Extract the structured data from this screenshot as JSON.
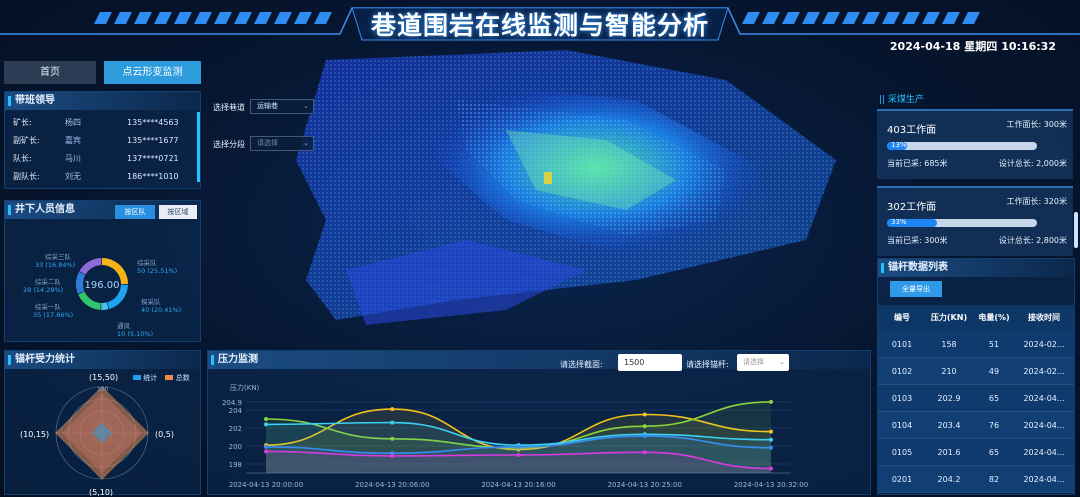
{
  "header": {
    "title": "巷道围岩在线监测与智能分析",
    "date": "2024-04-18",
    "weekday": "星期四",
    "time": "10:16:32"
  },
  "nav": {
    "home": "首页",
    "cloud": "点云形变监测"
  },
  "leaders": {
    "title": "带班领导",
    "rows": [
      {
        "role": "矿长:",
        "name": "杨四",
        "phone": "135****4563"
      },
      {
        "role": "副矿长:",
        "name": "嘉宾",
        "phone": "135****1677"
      },
      {
        "role": "队长:",
        "name": "马川",
        "phone": "137****0721"
      },
      {
        "role": "副队长:",
        "name": "刘无",
        "phone": "186****1010"
      }
    ]
  },
  "personnel": {
    "title": "井下人员信息",
    "tab_team": "按区队",
    "tab_area": "按区域",
    "total": "196.00",
    "segments": [
      {
        "label": "综采队",
        "value": "50 (25.51%)",
        "count": 50,
        "color": "#f5b316"
      },
      {
        "label": "探采队",
        "value": "40 (20.41%)",
        "count": 40,
        "color": "#1ea2f0"
      },
      {
        "label": "通风",
        "value": "10 (5.10%)",
        "count": 10,
        "color": "#4cc3e6"
      },
      {
        "label": "综采一队",
        "value": "35 (17.86%)",
        "count": 35,
        "color": "#33c36b"
      },
      {
        "label": "综采二队",
        "value": "28 (14.29%)",
        "count": 28,
        "color": "#2f7bd6"
      },
      {
        "label": "综采三队",
        "value": "33 (16.84%)",
        "count": 33,
        "color": "#8e6ad9"
      }
    ]
  },
  "anchor_force": {
    "title": "锚杆受力统计",
    "legend_stat": "统计",
    "legend_total": "总数",
    "scale_label": "100",
    "points": {
      "top": "(15,50)",
      "right": "(0,5)",
      "bottom": "(5,10)",
      "left": "(10,15)"
    }
  },
  "controls": {
    "tunnel_label": "选择巷道",
    "tunnel_value": "运输巷",
    "section_label": "选择分段",
    "section_value": "请选择"
  },
  "production": {
    "title": "|| 采煤生产",
    "faces": [
      {
        "name": "403工作面",
        "face_len": "工作面长: 300米",
        "progress": 0.13,
        "progress_text": "13%",
        "mined": "当前已采: 685米",
        "total": "设计总长: 2,000米"
      },
      {
        "name": "302工作面",
        "face_len": "工作面长: 320米",
        "progress": 0.33,
        "progress_text": "33%",
        "mined": "当前已采: 300米",
        "total": "设计总长: 2,800米"
      }
    ]
  },
  "anchor_table": {
    "title": "锚杆数据列表",
    "export": "全量导出",
    "headers": [
      "编号",
      "压力(KN)",
      "电量(%)",
      "接收时间"
    ],
    "rows": [
      [
        "0101",
        "158",
        "51",
        "2024-02..."
      ],
      [
        "0102",
        "210",
        "49",
        "2024-02..."
      ],
      [
        "0103",
        "202.9",
        "65",
        "2024-04..."
      ],
      [
        "0104",
        "203.4",
        "76",
        "2024-04..."
      ],
      [
        "0105",
        "201.6",
        "65",
        "2024-04..."
      ],
      [
        "0201",
        "204.2",
        "82",
        "2024-04..."
      ]
    ]
  },
  "pressure": {
    "title": "压力监测",
    "section_label": "请选择截面:",
    "section_value": "1500",
    "anchor_label": "请选择锚杆:",
    "anchor_value": "请选择"
  },
  "chart_data": {
    "type": "line",
    "ylabel": "压力(KN)",
    "ylim": [
      197,
      205
    ],
    "yticks": [
      198,
      200,
      202,
      204,
      204.9
    ],
    "x": [
      "2024-04-13 20:00:00",
      "2024-04-13 20:06:00",
      "2024-04-13 20:16:00",
      "2024-04-13 20:25:00",
      "2024-04-13 20:32:00"
    ],
    "series": [
      {
        "color": "#f5c21a",
        "values": [
          200.1,
          204.1,
          199.6,
          203.5,
          201.6
        ]
      },
      {
        "color": "#8ad43a",
        "values": [
          203.0,
          200.8,
          199.8,
          202.2,
          204.9
        ]
      },
      {
        "color": "#3ad1f2",
        "values": [
          202.4,
          202.6,
          200.1,
          201.3,
          200.7
        ]
      },
      {
        "color": "#3a8cf2",
        "values": [
          199.9,
          199.2,
          199.9,
          201.1,
          199.8
        ]
      },
      {
        "color": "#d93ae0",
        "values": [
          199.4,
          198.9,
          199.0,
          199.3,
          197.5
        ]
      }
    ]
  }
}
